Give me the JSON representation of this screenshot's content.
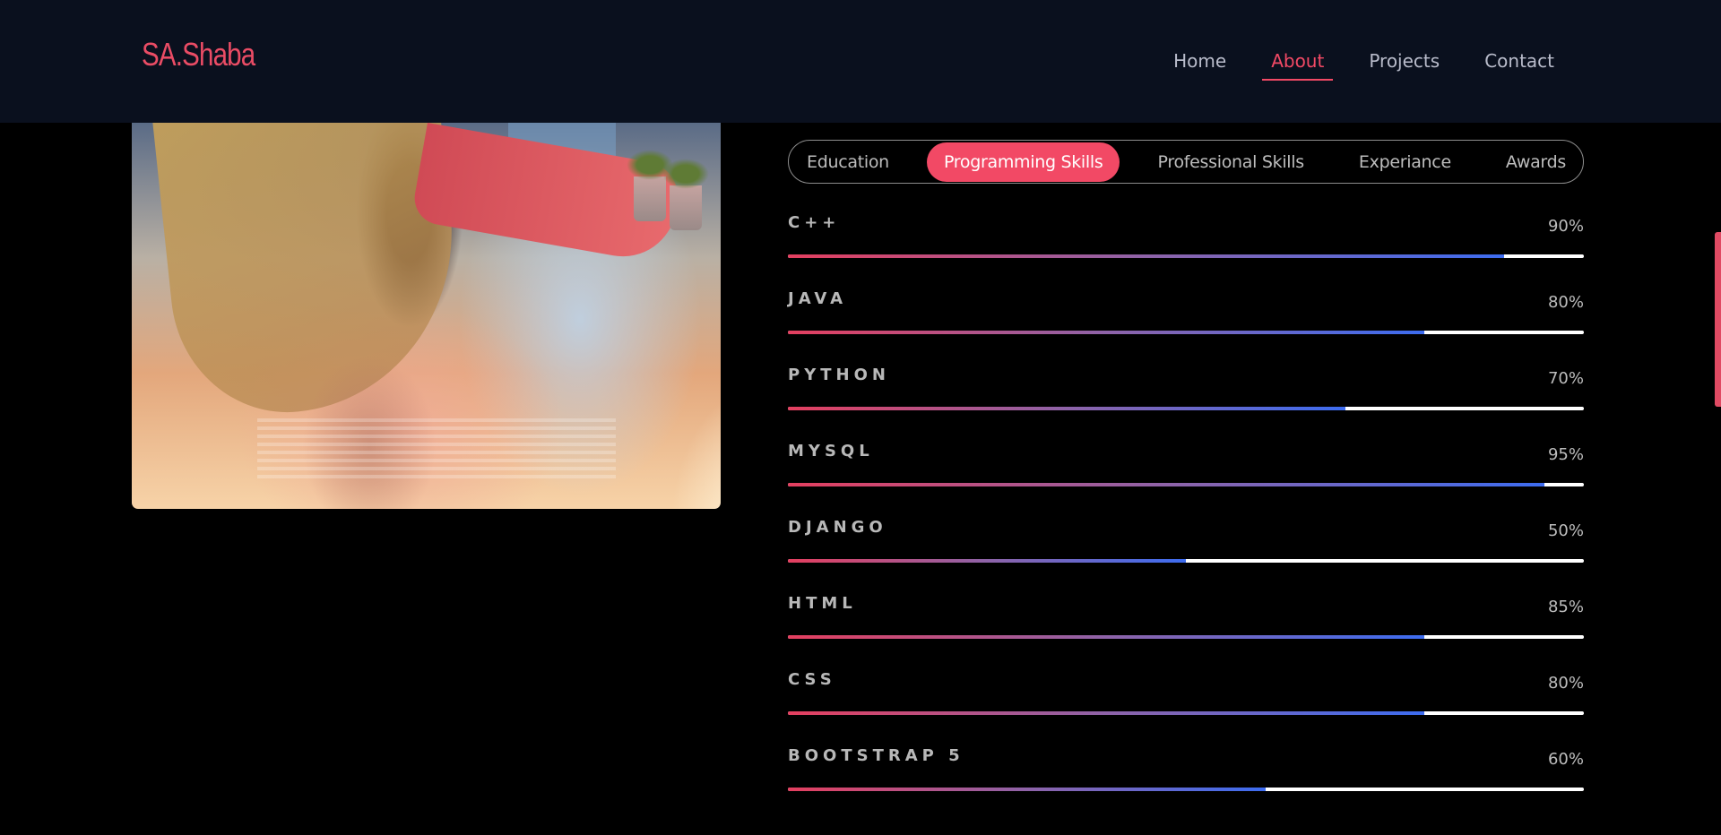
{
  "header": {
    "logo": "SA.Shaba",
    "nav": [
      {
        "label": "Home",
        "active": false
      },
      {
        "label": "About",
        "active": true
      },
      {
        "label": "Projects",
        "active": false
      },
      {
        "label": "Contact",
        "active": false
      }
    ]
  },
  "tabs": [
    {
      "label": "Education",
      "active": false
    },
    {
      "label": "Programming Skills",
      "active": true
    },
    {
      "label": "Professional Skills",
      "active": false
    },
    {
      "label": "Experiance",
      "active": false
    },
    {
      "label": "Awards",
      "active": false
    }
  ],
  "skills": [
    {
      "name": "C++",
      "percent_label": "90%",
      "level": 0.9
    },
    {
      "name": "JAVA",
      "percent_label": "80%",
      "level": 0.8
    },
    {
      "name": "PYTHON",
      "percent_label": "70%",
      "level": 0.7
    },
    {
      "name": "MYSQL",
      "percent_label": "95%",
      "level": 0.95
    },
    {
      "name": "DJANGO",
      "percent_label": "50%",
      "level": 0.5
    },
    {
      "name": "HTML",
      "percent_label": "85%",
      "level": 0.8
    },
    {
      "name": "CSS",
      "percent_label": "80%",
      "level": 0.8
    },
    {
      "name": "BOOTSTRAP 5",
      "percent_label": "60%",
      "level": 0.6
    }
  ],
  "colors": {
    "accent": "#f24965",
    "header_bg": "#0a101e",
    "bar_gradient": [
      "#e43f5f",
      "#8e63a8",
      "#3d6cf0"
    ]
  }
}
